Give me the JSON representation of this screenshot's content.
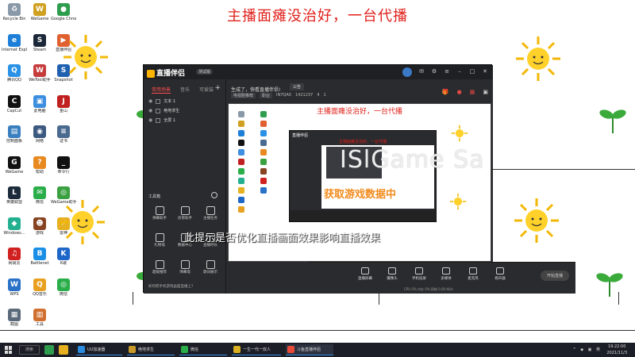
{
  "desktop": {
    "headline": "主播面瘫没治好，一台代播",
    "icons": [
      {
        "label": "Recycle Bin",
        "color": "#8a99a8",
        "glyph": "♻"
      },
      {
        "label": "WeGame",
        "color": "#d0a020",
        "glyph": "W"
      },
      {
        "label": "Google Chrome",
        "color": "#2e9d4e",
        "glyph": "●"
      },
      {
        "label": "Internet Explorer",
        "color": "#1e7fd8",
        "glyph": "e"
      },
      {
        "label": "Steam",
        "color": "#1b2838",
        "glyph": "S"
      },
      {
        "label": "直播伴侣",
        "color": "#e06030",
        "glyph": "▶"
      },
      {
        "label": "腾讯QQ",
        "color": "#2a92e6",
        "glyph": "Q"
      },
      {
        "label": "WeTool助手",
        "color": "#c63b3b",
        "glyph": "W"
      },
      {
        "label": "Snapshot",
        "color": "#2060b0",
        "glyph": "S"
      },
      {
        "label": "CapCut",
        "color": "#111111",
        "glyph": "C"
      },
      {
        "label": "此电脑",
        "color": "#3e8ee0",
        "glyph": "▣"
      },
      {
        "label": "金山",
        "color": "#c02020",
        "glyph": "J"
      },
      {
        "label": "控制面板",
        "color": "#3a7fc0",
        "glyph": "▤"
      },
      {
        "label": "网络",
        "color": "#3c5a80",
        "glyph": "◉"
      },
      {
        "label": "证书",
        "color": "#4a6a90",
        "glyph": "≡"
      },
      {
        "label": "WeGame",
        "color": "#111111",
        "glyph": "G"
      },
      {
        "label": "帮助",
        "color": "#e88a20",
        "glyph": "?"
      },
      {
        "label": "命令行",
        "color": "#111111",
        "glyph": "_"
      },
      {
        "label": "英雄联盟",
        "color": "#1c2b3a",
        "glyph": "L"
      },
      {
        "label": "微信",
        "color": "#2aae4a",
        "glyph": "✉"
      },
      {
        "label": "WeGame助手",
        "color": "#3aa040",
        "glyph": "◎"
      },
      {
        "label": "Windows...",
        "color": "#23b090",
        "glyph": "◆"
      },
      {
        "label": "游戏",
        "color": "#884422",
        "glyph": "☻"
      },
      {
        "label": "雷神",
        "color": "#e6b020",
        "glyph": "⚡"
      },
      {
        "label": "网易云",
        "color": "#d02020",
        "glyph": "♫"
      },
      {
        "label": "Battlenet",
        "color": "#1a8fe6",
        "glyph": "B"
      },
      {
        "label": "K歌",
        "color": "#1e66c8",
        "glyph": "K"
      },
      {
        "label": "WPS",
        "color": "#2a72c8",
        "glyph": "W"
      },
      {
        "label": "QQ音乐",
        "color": "#e8a020",
        "glyph": "Q"
      },
      {
        "label": "微信",
        "color": "#2aae4a",
        "glyph": "◎"
      },
      {
        "label": "截图",
        "color": "#5a6a7a",
        "glyph": "▦"
      },
      {
        "label": "工具",
        "color": "#d07030",
        "glyph": "▥"
      }
    ]
  },
  "app": {
    "logo_text": "直播伴侣",
    "version": "测试版",
    "left_tabs": [
      "常用场景",
      "音乐",
      "可爱装"
    ],
    "scenes": [
      "文本 1",
      "绝地求生",
      "全屏 1"
    ],
    "tools_title": "工具箱",
    "tools": [
      "弹幕助手",
      "房管助手",
      "主播任务",
      "礼物墙",
      "数据中心",
      "直播时长",
      "超级推荐",
      "弹幕墙",
      "歌词展示"
    ],
    "notice": "如何把手机游戏画面直播上?",
    "greeting": "生成了，快看直播伴侣!",
    "announce_btn": "公告",
    "meta": [
      "电视剧推荐",
      "职业",
      "IN7QA0",
      "1421237",
      "4",
      "1"
    ],
    "preview": {
      "headline": "主播面瘫没治好，一台代播",
      "nested_title": "直播伴侣",
      "nested_headline": "主播面瘫没治好，一台代播",
      "watermark": "ISlGame Sa",
      "overlay": "获取游戏数据中"
    },
    "subtitle": "此提示是否优化直播画面效果影响直播效果",
    "bottom_tools": [
      "直播屏幕",
      "摄像头",
      "手机投屏",
      "多媒体",
      "麦克风",
      "扬声器"
    ],
    "start_live": "开始直播",
    "stats": "CPU 0%  内存 0%  网络 0.00 Kb/s"
  },
  "taskbar": {
    "search": "搜索",
    "apps": [
      {
        "label": "UU加速器",
        "color": "#2a8ce0"
      },
      {
        "label": "绝地求生",
        "color": "#c89a2a"
      },
      {
        "label": "微信",
        "color": "#2aae4a"
      },
      {
        "label": "一生一代一双人 (Live)",
        "color": "#d8b020"
      },
      {
        "label": "斗鱼直播伴侣",
        "color": "#e84a3a"
      }
    ],
    "tray": "^ ◆ ▣ 英",
    "time": "19:22:00",
    "date": "2021/11/3"
  }
}
